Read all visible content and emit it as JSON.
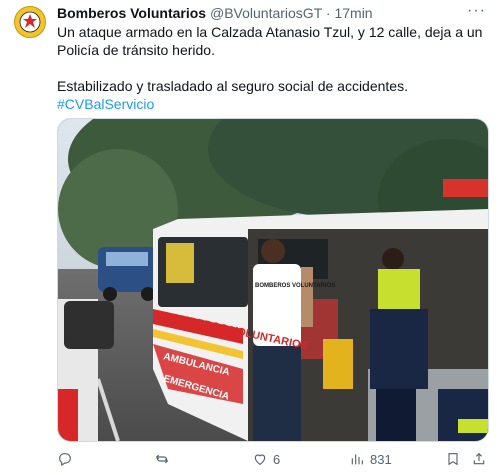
{
  "tweet": {
    "display_name": "Bomberos Voluntarios",
    "handle": "@BVoluntariosGT",
    "separator": "·",
    "time": "17min",
    "more_label": "···",
    "text_line1": "Un ataque armado en la Calzada Atanasio Tzul, y 12 calle, deja a un Policía de tránsito herido.",
    "text_line2": "Estabilizado y trasladado al seguro social de accidentes.",
    "hashtag": "#CVBalServicio"
  },
  "media": {
    "ambulance_side_text": "BOMBEROS VOLUNTARIOS",
    "ambulance_side_text2": "AMBULANCIA",
    "ambulance_side_text3": "EMERGENCIA",
    "vest_text": "BOMBEROS VOLUNTARIOS"
  },
  "actions": {
    "reply_count": "",
    "retweet_count": "",
    "like_count": "6",
    "views_count": "831"
  },
  "icons": {
    "reply": "reply-icon",
    "retweet": "retweet-icon",
    "like": "heart-icon",
    "views": "views-icon",
    "bookmark": "bookmark-icon",
    "share": "share-icon"
  }
}
